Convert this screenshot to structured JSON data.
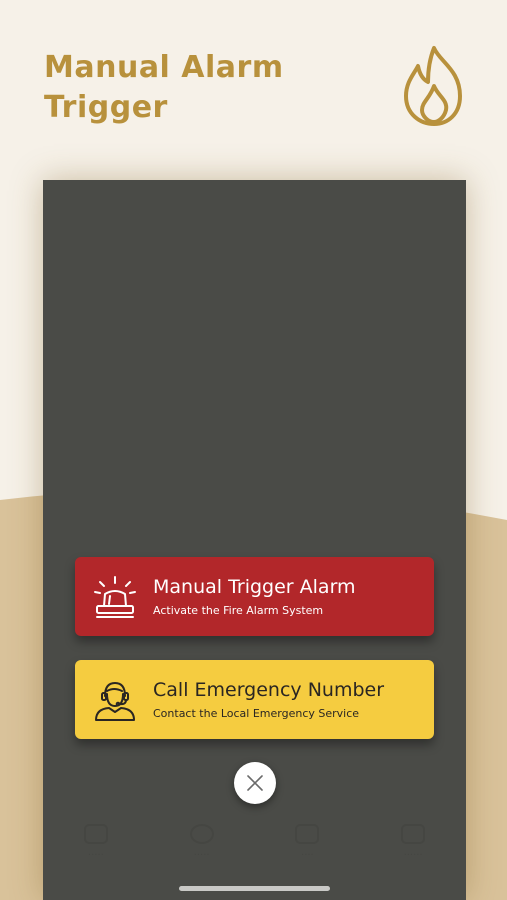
{
  "header": {
    "title_line1": "Manual Alarm",
    "title_line2": "Trigger",
    "icon": "flame-icon"
  },
  "colors": {
    "background": "#f6f1e8",
    "accent_gold": "#b8913c",
    "overlay": "#4a4b47",
    "alarm_red": "#b2272a",
    "emergency_yellow": "#f5cc40"
  },
  "actions": [
    {
      "title": "Manual Trigger Alarm",
      "subtitle": "Activate the Fire Alarm System",
      "icon": "siren-icon"
    },
    {
      "title": "Call Emergency Number",
      "subtitle": "Contact the Local Emergency Service",
      "icon": "operator-headset-icon"
    }
  ],
  "close_icon": "close-icon"
}
